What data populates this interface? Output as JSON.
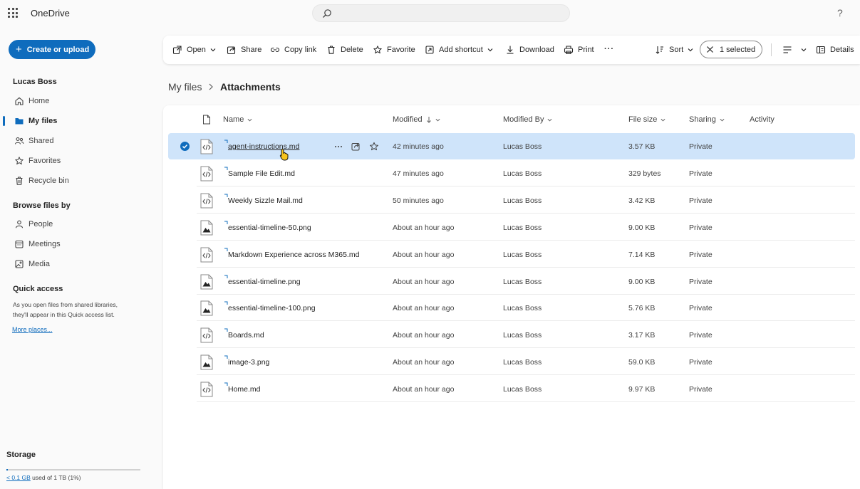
{
  "app": {
    "title": "OneDrive"
  },
  "search": {
    "placeholder": ""
  },
  "help": {
    "label": "?"
  },
  "sidebar": {
    "create_label": "Create or upload",
    "user_name": "Lucas Boss",
    "nav": [
      {
        "label": "Home",
        "icon": "home-icon"
      },
      {
        "label": "My files",
        "icon": "folder-icon",
        "active": true
      },
      {
        "label": "Shared",
        "icon": "people-icon"
      },
      {
        "label": "Favorites",
        "icon": "star-icon"
      },
      {
        "label": "Recycle bin",
        "icon": "trash-icon"
      }
    ],
    "browse_heading": "Browse files by",
    "browse": [
      {
        "label": "People",
        "icon": "person-icon"
      },
      {
        "label": "Meetings",
        "icon": "calendar-icon"
      },
      {
        "label": "Media",
        "icon": "image-icon"
      }
    ],
    "quick_access_heading": "Quick access",
    "quick_access_text": "As you open files from shared libraries, they'll appear in this Quick access list.",
    "more_places": "More places...",
    "storage_heading": "Storage",
    "storage_used_link": "< 0.1 GB",
    "storage_used_rest": " used of 1 TB (1%)",
    "storage_fraction": 0.01
  },
  "toolbar": {
    "open": "Open",
    "share": "Share",
    "copy_link": "Copy link",
    "delete": "Delete",
    "favorite": "Favorite",
    "add_shortcut": "Add shortcut",
    "download": "Download",
    "print": "Print",
    "more": "···",
    "sort": "Sort",
    "selected": "1 selected",
    "details": "Details"
  },
  "breadcrumb": {
    "root": "My files",
    "current": "Attachments"
  },
  "columns": {
    "name": "Name",
    "modified": "Modified",
    "modified_by": "Modified By",
    "file_size": "File size",
    "sharing": "Sharing",
    "activity": "Activity"
  },
  "files": [
    {
      "name": "agent-instructions.md",
      "modified": "42 minutes ago",
      "modified_by": "Lucas Boss",
      "size": "3.57 KB",
      "sharing": "Private",
      "type": "code",
      "selected": true
    },
    {
      "name": "Sample File Edit.md",
      "modified": "47 minutes ago",
      "modified_by": "Lucas Boss",
      "size": "329 bytes",
      "sharing": "Private",
      "type": "code"
    },
    {
      "name": "Weekly Sizzle Mail.md",
      "modified": "50 minutes ago",
      "modified_by": "Lucas Boss",
      "size": "3.42 KB",
      "sharing": "Private",
      "type": "code"
    },
    {
      "name": "essential-timeline-50.png",
      "modified": "About an hour ago",
      "modified_by": "Lucas Boss",
      "size": "9.00 KB",
      "sharing": "Private",
      "type": "image"
    },
    {
      "name": "Markdown Experience across M365.md",
      "modified": "About an hour ago",
      "modified_by": "Lucas Boss",
      "size": "7.14 KB",
      "sharing": "Private",
      "type": "code"
    },
    {
      "name": "essential-timeline.png",
      "modified": "About an hour ago",
      "modified_by": "Lucas Boss",
      "size": "9.00 KB",
      "sharing": "Private",
      "type": "image"
    },
    {
      "name": "essential-timeline-100.png",
      "modified": "About an hour ago",
      "modified_by": "Lucas Boss",
      "size": "5.76 KB",
      "sharing": "Private",
      "type": "image"
    },
    {
      "name": "Boards.md",
      "modified": "About an hour ago",
      "modified_by": "Lucas Boss",
      "size": "3.17 KB",
      "sharing": "Private",
      "type": "code"
    },
    {
      "name": "image-3.png",
      "modified": "About an hour ago",
      "modified_by": "Lucas Boss",
      "size": "59.0 KB",
      "sharing": "Private",
      "type": "image"
    },
    {
      "name": "Home.md",
      "modified": "About an hour ago",
      "modified_by": "Lucas Boss",
      "size": "9.97 KB",
      "sharing": "Private",
      "type": "code"
    }
  ],
  "colors": {
    "accent": "#0f6cbd",
    "selected_row": "#cfe4fa"
  }
}
